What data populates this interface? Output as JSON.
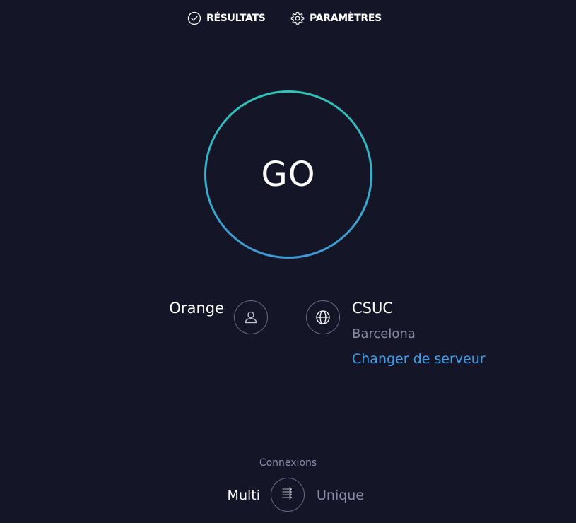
{
  "nav": {
    "results_label": "RÉSULTATS",
    "results_icon": "check-circle-icon",
    "settings_label": "PARAMÈTRES",
    "settings_icon": "gear-icon"
  },
  "go_button": {
    "label": "GO"
  },
  "isp": {
    "name": "Orange",
    "icon": "user-icon"
  },
  "server": {
    "name": "CSUC",
    "location": "Barcelona",
    "change_label": "Changer de serveur",
    "icon": "globe-icon"
  },
  "connections": {
    "label": "Connexions",
    "multi_label": "Multi",
    "single_label": "Unique",
    "selected": "Multi",
    "icon": "multi-arrows-icon"
  },
  "colors": {
    "background": "#141526",
    "ring_start": "#2ec4b6",
    "ring_end": "#3f9ad8",
    "link": "#3da0ec",
    "muted_text": "#8c8da2"
  }
}
